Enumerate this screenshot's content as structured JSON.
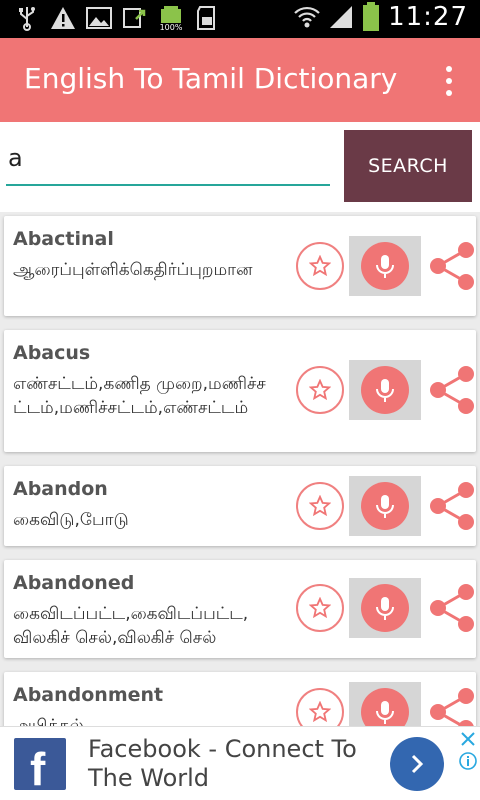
{
  "status_bar": {
    "time": "11:27",
    "battery_icon_label": "100%",
    "left_icons": [
      "usb-icon",
      "warning-icon",
      "image-icon",
      "download-icon",
      "battery-full-icon",
      "sd-card-icon"
    ],
    "right_icons": [
      "wifi-icon",
      "signal-icon",
      "battery-icon"
    ]
  },
  "app_bar": {
    "title": "English To Tamil Dictionary",
    "menu_icon": "more-vert-icon",
    "color": "#f07575"
  },
  "search": {
    "value": "a",
    "button_label": "SEARCH",
    "button_color": "#6a3a47",
    "underline_color": "#26a69a"
  },
  "entries": [
    {
      "word": "Abactinal",
      "meaning": "ஆரைப்புள்ளிக்கெதிர்ப்புறமான"
    },
    {
      "word": "Abacus",
      "meaning": "எண்சட்டம்,கணித முறை,மணிச்சட்டம்,மணிச்சட்டம்,எண்சட்டம்"
    },
    {
      "word": "Abandon",
      "meaning": "கைவிடு,போடு"
    },
    {
      "word": "Abandoned",
      "meaning": "கைவிடப்பட்ட,கைவிடப்பட்ட, விலகிச் செல்,விலகிச் செல்"
    },
    {
      "word": "Abandonment",
      "meaning": "அபித்தல்"
    }
  ],
  "ad": {
    "text": "Facebook - Connect To The World",
    "logo_letter": "f",
    "brand_color": "#3b5998"
  }
}
